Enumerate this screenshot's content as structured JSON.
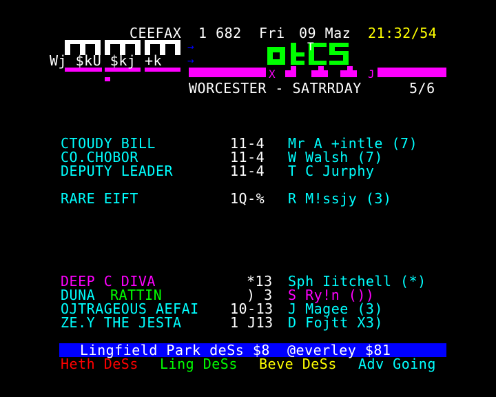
{
  "header": {
    "service": "CEEFAX",
    "page": "1 682",
    "day": "Fri",
    "date": "09 Maz",
    "time": "21:32/54",
    "logo_text": "Wj $kU $kj +k",
    "arrows": [
      "→",
      "→"
    ],
    "brand_marks": [
      "T",
      "X",
      "J"
    ],
    "title": "WORCESTER - SATRRDAY",
    "subpage": "5/6"
  },
  "race_1": [
    {
      "horse": "CTOUDY BILL",
      "odds": "11-4",
      "jockey": "Mr A +intle (7)"
    },
    {
      "horse": "CO.CHOBOR",
      "odds": "11-4",
      "jockey": "W Walsh (7)"
    },
    {
      "horse": "DEPUTY LEADER",
      "odds": "11-4",
      "jockey": "T C Jurphy"
    },
    {
      "horse": "RARE EIFT",
      "odds": "1Q-%",
      "jockey": "R M!ssjy (3)"
    }
  ],
  "race_2": [
    {
      "horse": "DEEP C DIVA",
      "odds": "*13",
      "jockey": "Sph Iitchell (*)"
    },
    {
      "horse": "DUNA",
      "horse_part2": "RATTIN",
      "odds": ") 3",
      "jockey": "S Ry!n ())"
    },
    {
      "horse": "OJTRAGEOUS AEFAI",
      "odds": "10-13",
      "jockey": "J Magee (3)"
    },
    {
      "horse": "ZE.Y THE JESTA",
      "odds": "1 J13",
      "jockey": "D Fojtt X3)"
    }
  ],
  "footer": {
    "banner": "Lingfield Park deSs $8  @everley $81",
    "links": [
      "Heth DeSs",
      "Ling DeSs",
      "Beve DeSs",
      "Adv Going"
    ]
  },
  "colors": {
    "background": "#000000",
    "white": "#ffffff",
    "yellow": "#ffff00",
    "cyan": "#00ffff",
    "magenta": "#ff00ff",
    "green": "#00ff00",
    "red": "#ff0000",
    "blue": "#0000ff"
  }
}
